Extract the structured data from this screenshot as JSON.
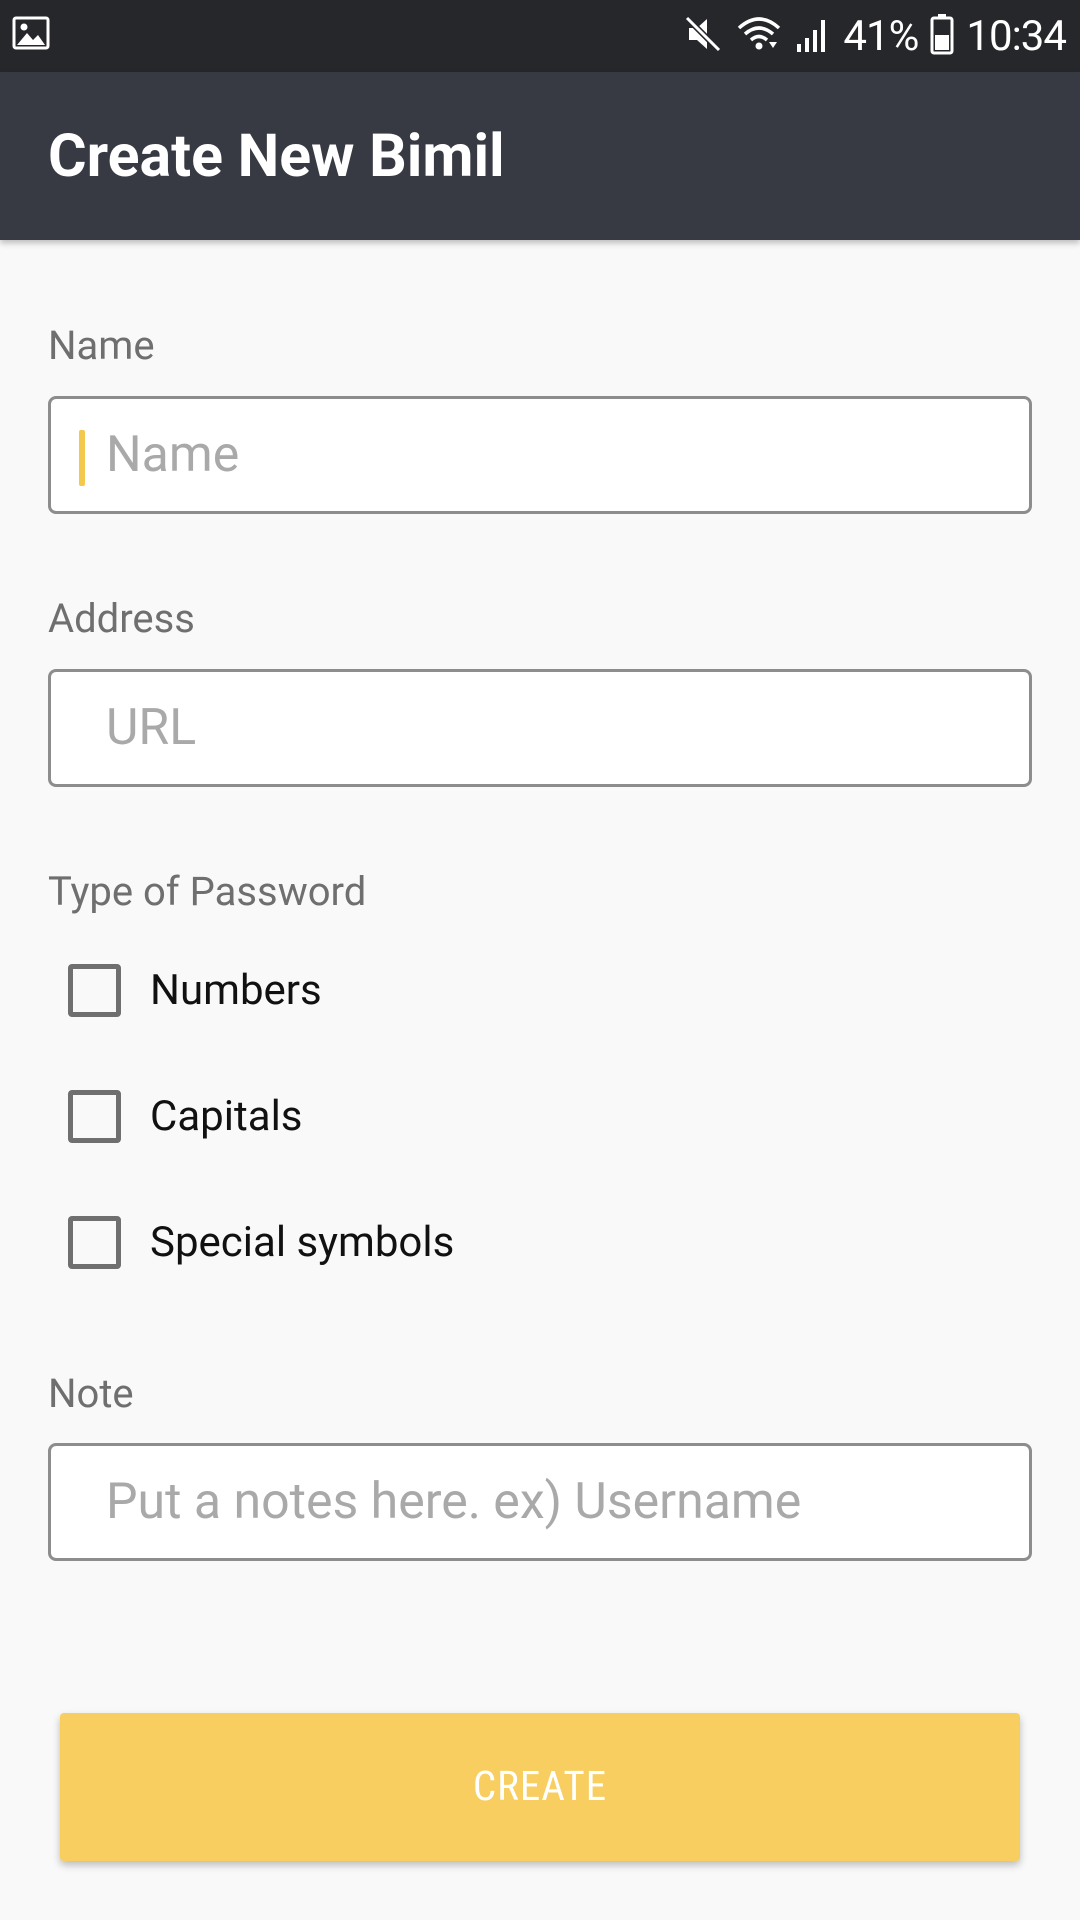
{
  "status_bar": {
    "battery_percent": "41%",
    "time": "10:34",
    "icons": [
      "image-icon",
      "mute-icon",
      "wifi-icon",
      "signal-icon",
      "battery-icon"
    ]
  },
  "app_bar": {
    "title": "Create New Bimil"
  },
  "form": {
    "name": {
      "label": "Name",
      "placeholder": "Name",
      "value": ""
    },
    "address": {
      "label": "Address",
      "placeholder": "URL",
      "value": ""
    },
    "password_type": {
      "label": "Type of Password",
      "options": [
        {
          "label": "Numbers",
          "checked": false
        },
        {
          "label": "Capitals",
          "checked": false
        },
        {
          "label": "Special symbols",
          "checked": false
        }
      ]
    },
    "note": {
      "label": "Note",
      "placeholder": "Put a notes here. ex) Username",
      "value": ""
    },
    "create_label": "CREATE"
  },
  "colors": {
    "status_bar_bg": "#26272b",
    "app_bar_bg": "#383a43",
    "accent": "#f7ce5f",
    "page_bg": "#f9f9f9"
  }
}
